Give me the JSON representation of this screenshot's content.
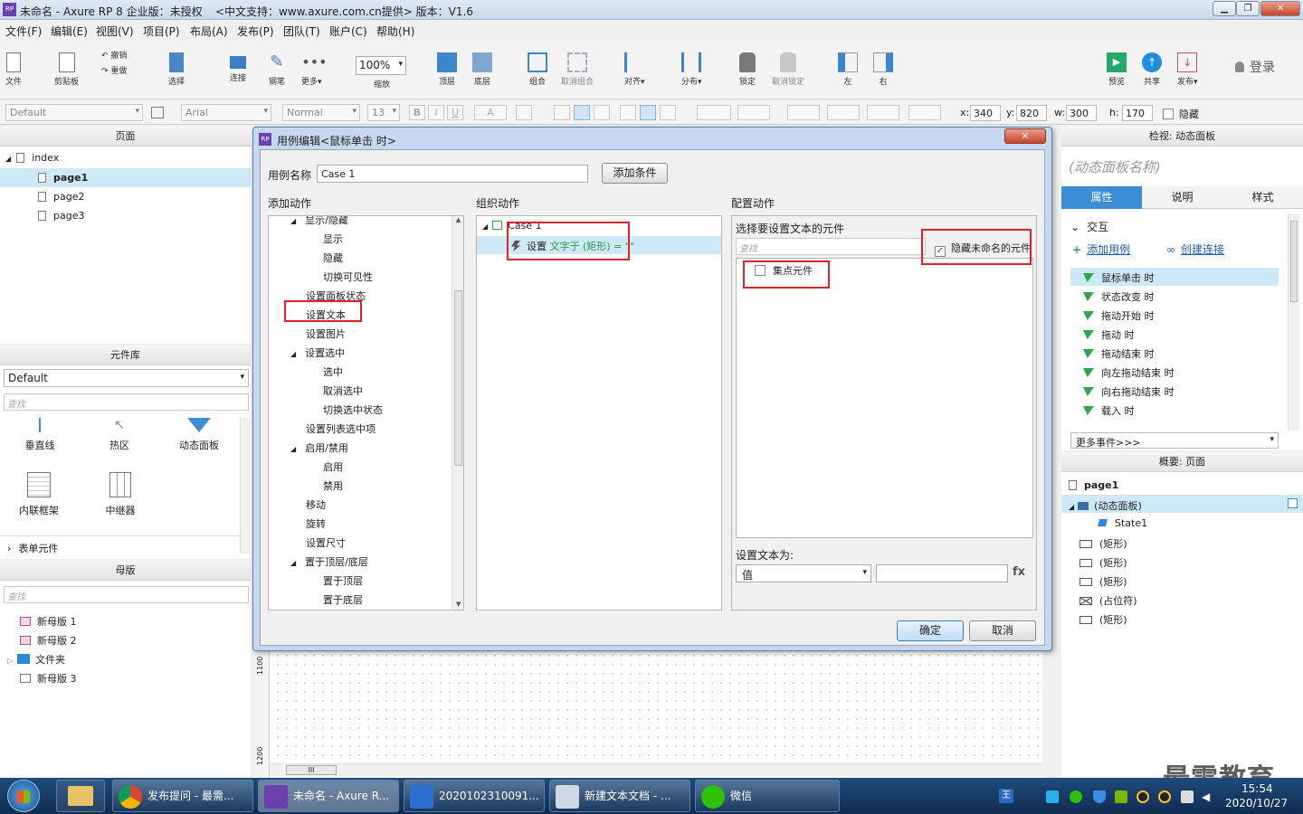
{
  "window": {
    "title": "未命名 - Axure RP 8 企业版：未授权",
    "support": "<中文支持：www.axure.com.cn提供> 版本：V1.6"
  },
  "menu": [
    "文件(F)",
    "编辑(E)",
    "视图(V)",
    "项目(P)",
    "布局(A)",
    "发布(P)",
    "团队(T)",
    "账户(C)",
    "帮助(H)"
  ],
  "toolbar": {
    "file": "文件",
    "clipboard": "剪贴板",
    "undo": "撤销",
    "redo": "重做",
    "select": "选择",
    "connect": "连接",
    "pen": "钢笔",
    "more": "更多▾",
    "zoom_value": "100%",
    "zoom": "缩放",
    "top": "顶层",
    "bottom": "底层",
    "group": "组合",
    "ungroup": "取消组合",
    "align": "对齐▾",
    "distribute": "分布▾",
    "lock": "锁定",
    "unlock": "取消锁定",
    "left": "左",
    "right": "右",
    "preview": "预览",
    "share": "共享",
    "publish": "发布▾",
    "login": "登录"
  },
  "format": {
    "style": "Default",
    "font": "Arial",
    "weight": "Normal",
    "size": "13",
    "x_label": "x:",
    "x": "340",
    "y_label": "y:",
    "y": "820",
    "w_label": "w:",
    "w": "300",
    "h_label": "h:",
    "h": "170",
    "hidden": "隐藏"
  },
  "pages": {
    "header": "页面",
    "items": [
      "index",
      "page1",
      "page2",
      "page3"
    ]
  },
  "library": {
    "header": "元件库",
    "selected": "Default",
    "search": "查找",
    "widgets": [
      "垂直线",
      "热区",
      "动态面板",
      "内联框架",
      "中继器"
    ],
    "form_group": "表单元件"
  },
  "masters": {
    "header": "母版",
    "search": "查找",
    "items": [
      "新母版 1",
      "新母版 2",
      "文件夹",
      "新母版 3"
    ]
  },
  "dialog": {
    "title": "用例编辑<鼠标单击 时>",
    "case_name_label": "用例名称",
    "case_name": "Case 1",
    "add_condition": "添加条件",
    "add_action": "添加动作",
    "organize_action": "组织动作",
    "config_action": "配置动作",
    "actions": [
      {
        "label": "显示/隐藏",
        "level": 1,
        "expanded": true
      },
      {
        "label": "显示",
        "level": 2
      },
      {
        "label": "隐藏",
        "level": 2
      },
      {
        "label": "切换可见性",
        "level": 2
      },
      {
        "label": "设置面板状态",
        "level": 1
      },
      {
        "label": "设置文本",
        "level": 1
      },
      {
        "label": "设置图片",
        "level": 1
      },
      {
        "label": "设置选中",
        "level": 1,
        "expanded": true
      },
      {
        "label": "选中",
        "level": 2
      },
      {
        "label": "取消选中",
        "level": 2
      },
      {
        "label": "切换选中状态",
        "level": 2
      },
      {
        "label": "设置列表选中项",
        "level": 1
      },
      {
        "label": "启用/禁用",
        "level": 1,
        "expanded": true
      },
      {
        "label": "启用",
        "level": 2
      },
      {
        "label": "禁用",
        "level": 2
      },
      {
        "label": "移动",
        "level": 1
      },
      {
        "label": "旋转",
        "level": 1
      },
      {
        "label": "设置尺寸",
        "level": 1
      },
      {
        "label": "置于顶层/底层",
        "level": 1,
        "expanded": true
      },
      {
        "label": "置于顶层",
        "level": 2
      },
      {
        "label": "置于底层",
        "level": 2
      }
    ],
    "case_node": "Case 1",
    "action_node_prefix": "设置",
    "action_node_detail": "文字于 (矩形) = \"\"",
    "select_widget_label": "选择要设置文本的元件",
    "search": "查找",
    "hide_unnamed": "隐藏未命名的元件",
    "focus_widget": "集点元件",
    "set_text_label": "设置文本为:",
    "value_type": "值",
    "fx": "fx",
    "ok": "确定",
    "cancel": "取消"
  },
  "inspector": {
    "header": "检视: 动态面板",
    "name_placeholder": "(动态面板名称)",
    "tabs": [
      "属性",
      "说明",
      "样式"
    ],
    "section": "交互",
    "add_case": "添加用例",
    "create_link": "创建连接",
    "events": [
      "鼠标单击 时",
      "状态改变 时",
      "拖动开始 时",
      "拖动 时",
      "拖动结束 时",
      "向左拖动结束 时",
      "向右拖动结束 时",
      "载入 时"
    ],
    "more_events": "更多事件>>>"
  },
  "outline": {
    "header": "概要: 页面",
    "items": [
      {
        "label": "page1",
        "level": 0
      },
      {
        "label": "(动态面板)",
        "level": 0
      },
      {
        "label": "State1",
        "level": 1
      },
      {
        "label": "(矩形)",
        "level": 0
      },
      {
        "label": "(矩形)",
        "level": 0
      },
      {
        "label": "(矩形)",
        "level": 0
      },
      {
        "label": "(占位符)",
        "level": 0
      },
      {
        "label": "(矩形)",
        "level": 0
      }
    ]
  },
  "canvas": {
    "ruler_1100": "1100",
    "ruler_1200": "1200",
    "hscroll": "III"
  },
  "taskbar": {
    "items": [
      "发布提问 - 最需...",
      "未命名 - Axure R...",
      "2020102310091...",
      "新建文本文档 - ...",
      "微信"
    ],
    "date": "2020/10/27",
    "time": "15:54"
  },
  "watermark": "最需教育",
  "colors": {
    "accent": "#3c8fd6",
    "selected_row": "#cde8f7",
    "highlight": "#e0202a",
    "link": "#1a5fb4"
  }
}
